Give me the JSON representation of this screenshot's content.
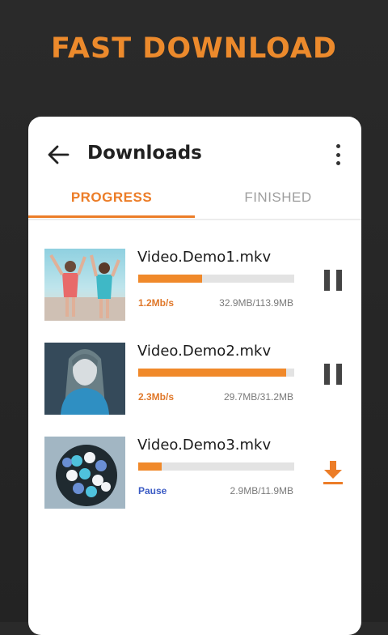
{
  "banner": "FAST DOWNLOAD",
  "header": {
    "title": "Downloads",
    "back_icon": "arrow-back-icon",
    "menu_icon": "more-vert-icon"
  },
  "tabs": [
    {
      "label": "PROGRESS",
      "active": true
    },
    {
      "label": "FINISHED",
      "active": false
    }
  ],
  "accent_color": "#ec7d28",
  "downloads": [
    {
      "name": "Video.Demo1.mkv",
      "speed": "1.2Mb/s",
      "size": "32.9MB/113.9MB",
      "progress": 0.41,
      "action_icon": "pause-icon"
    },
    {
      "name": "Video.Demo2.mkv",
      "speed": "2.3Mb/s",
      "size": "29.7MB/31.2MB",
      "progress": 0.95,
      "action_icon": "pause-icon"
    },
    {
      "name": "Video.Demo3.mkv",
      "speed": "Pause",
      "size": "2.9MB/11.9MB",
      "progress": 0.15,
      "action_icon": "download-icon"
    }
  ]
}
